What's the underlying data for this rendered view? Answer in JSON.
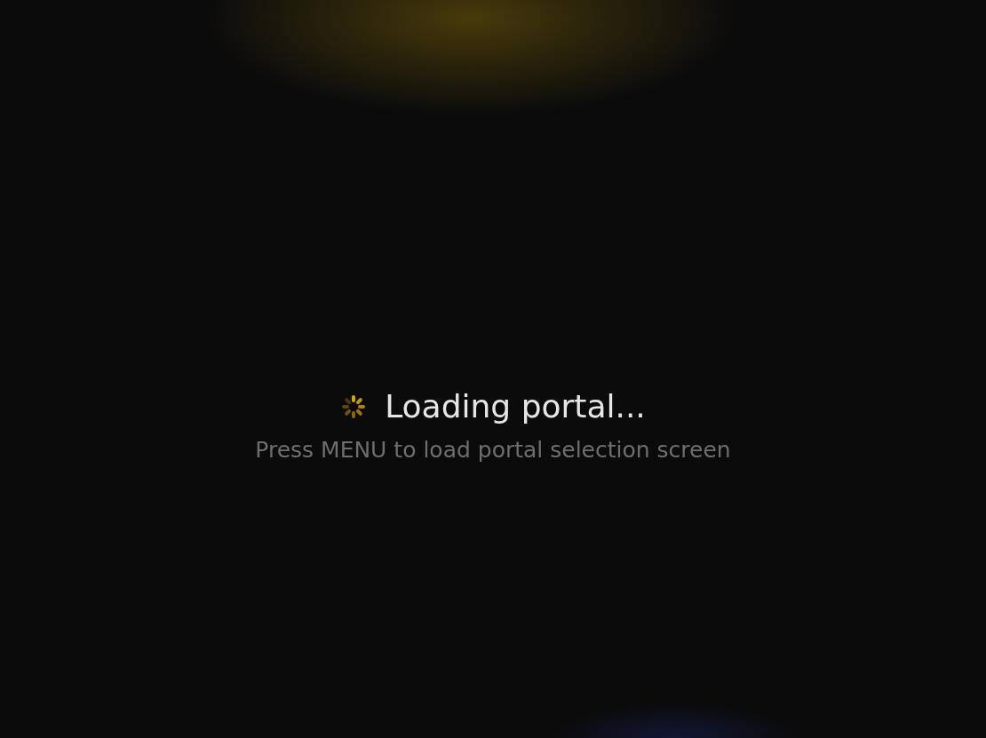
{
  "loading": {
    "title": "Loading portal...",
    "hint": "Press MENU to load portal selection screen"
  }
}
